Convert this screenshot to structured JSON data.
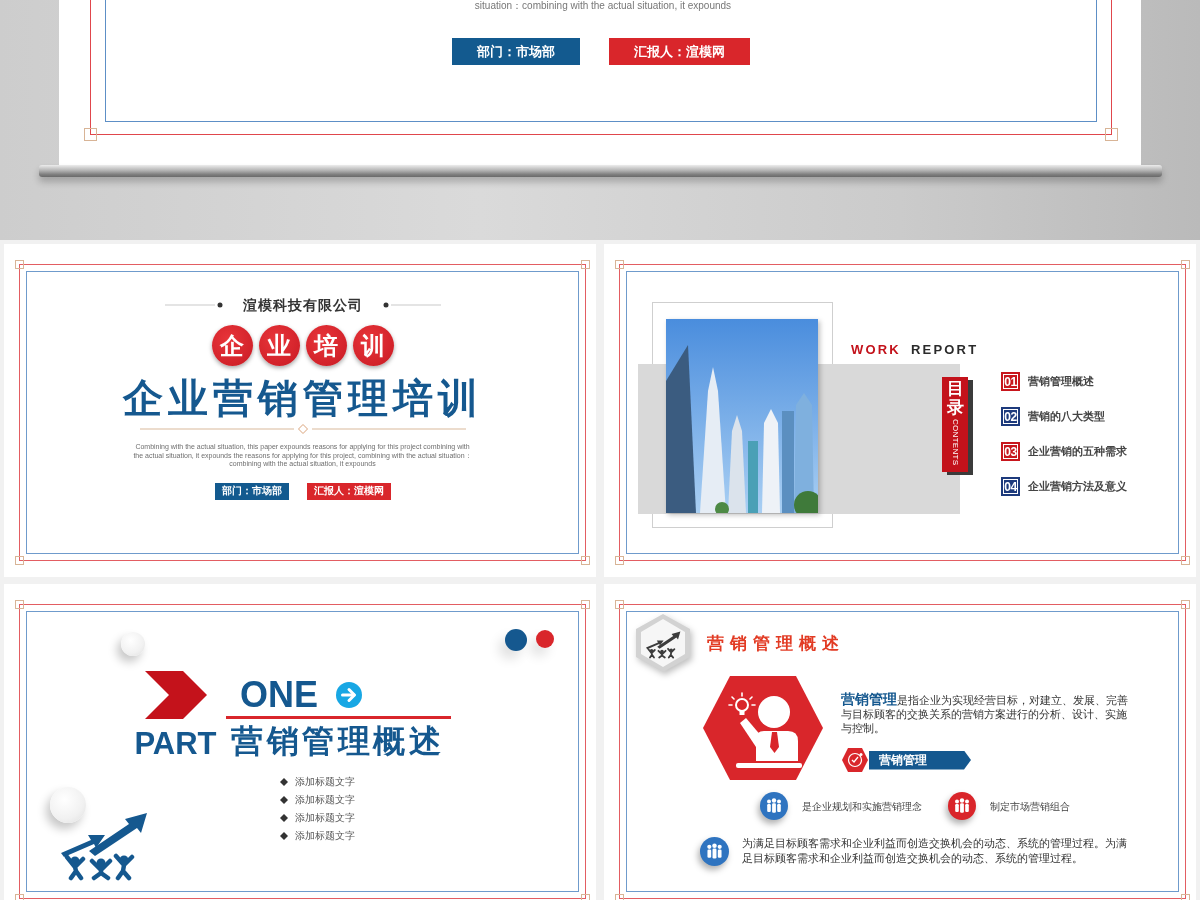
{
  "hero_slide": {
    "description": "situation：combining with the actual situation, it expounds",
    "department": "部门：市场部",
    "reporter": "汇报人：渲模网"
  },
  "slides": [
    {
      "kind": "cover",
      "company": "渲模科技有限公司",
      "badge_characters": [
        "企",
        "业",
        "培",
        "训"
      ],
      "title": "企业营销管理培训",
      "description": "Combining with the actual situation, this paper expounds reasons for applying for this project combining with the actual situation, it expounds the reasons for applying for this project, combining with the actual situation：combining with the actual situation, it expounds",
      "department": "部门：市场部",
      "reporter": "汇报人：渲模网"
    },
    {
      "kind": "contents",
      "heading_accent": "WORK",
      "heading": "REPORT",
      "tab_title": "目录",
      "tab_subtitle": "CONTENTS",
      "items": [
        {
          "number": "01",
          "label": "营销管理概述",
          "color": "#c8161d"
        },
        {
          "number": "02",
          "label": "营销的八大类型",
          "color": "#1d3a7c"
        },
        {
          "number": "03",
          "label": "企业营销的五种需求",
          "color": "#c8161d"
        },
        {
          "number": "04",
          "label": "企业营销方法及意义",
          "color": "#1d3a7c"
        }
      ]
    },
    {
      "kind": "section",
      "part_number": "ONE",
      "part_label": "PART",
      "title": "营销管理概述",
      "bullets": [
        "添加标题文字",
        "添加标题文字",
        "添加标题文字",
        "添加标题文字"
      ]
    },
    {
      "kind": "content",
      "title": "营销管理概述",
      "definition": "**营销管理**是指企业为实现经营目标，对建立、发展、完善与目标顾客的交换关系的营销方案进行的分析、设计、实施与控制。",
      "banner": "营销管理",
      "points": [
        {
          "text": "是企业规划和实施营销理念",
          "color": "#2f74c0"
        },
        {
          "text": "制定市场营销组合",
          "color": "#d9252a"
        }
      ],
      "summary": {
        "text": "为满足目标顾客需求和企业利益而创造交换机会的动态、系统的管理过程。为满足目标顾客需求和企业利益而创造交换机会的动态、系统的管理过程。",
        "color": "#2f74c0"
      }
    }
  ]
}
